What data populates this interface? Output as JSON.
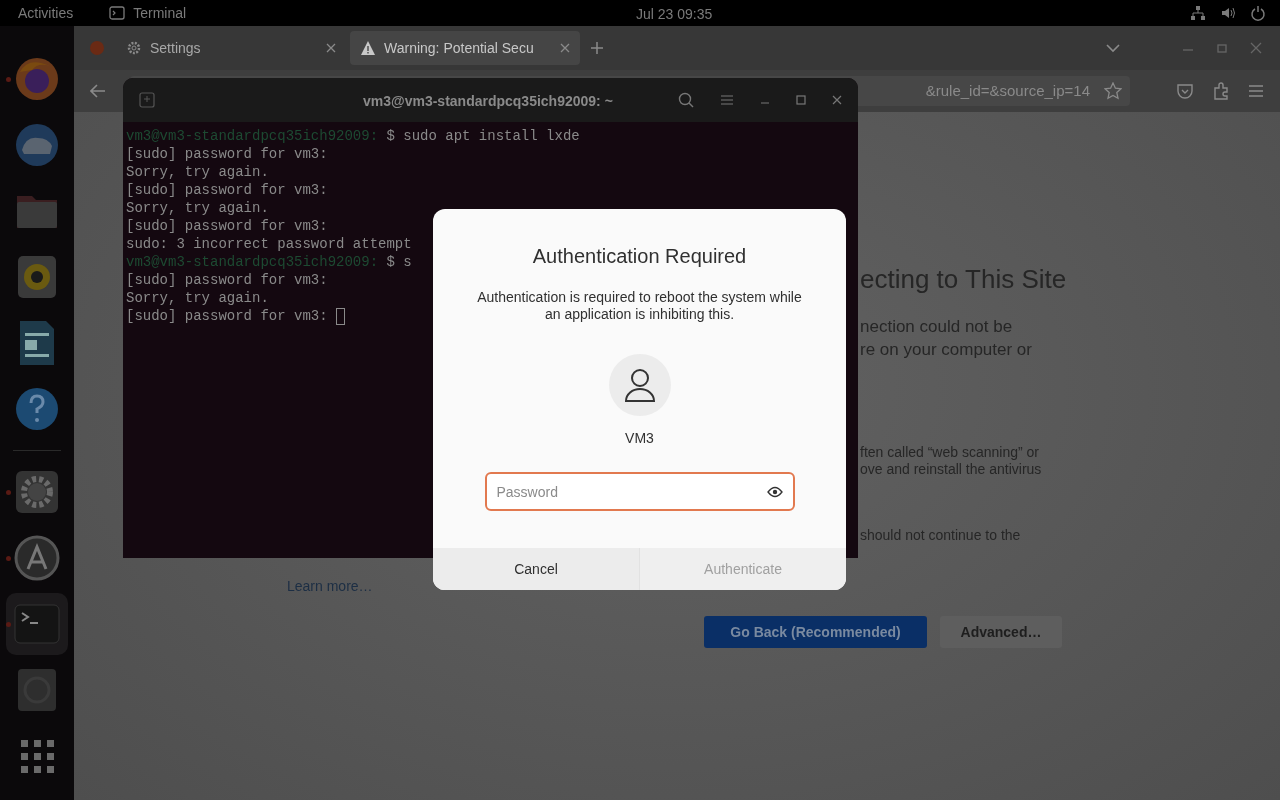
{
  "top_bar": {
    "activities": "Activities",
    "app": "Terminal",
    "clock": "Jul 23  09:35"
  },
  "dock": {
    "items": [
      {
        "kind": "firefox",
        "running": true,
        "selected": false
      },
      {
        "kind": "thunderbird",
        "running": false,
        "selected": false
      },
      {
        "kind": "files",
        "running": false,
        "selected": false
      },
      {
        "kind": "rhythmbox",
        "running": false,
        "selected": false
      },
      {
        "kind": "writer",
        "running": false,
        "selected": false
      },
      {
        "kind": "help",
        "running": false,
        "selected": false
      },
      {
        "kind": "separator"
      },
      {
        "kind": "settings",
        "running": true,
        "selected": false
      },
      {
        "kind": "software",
        "running": true,
        "selected": false
      },
      {
        "kind": "terminal",
        "running": true,
        "selected": true
      },
      {
        "kind": "disc",
        "running": false,
        "selected": false
      },
      {
        "kind": "apps",
        "running": false,
        "selected": false
      }
    ]
  },
  "browser": {
    "tabs": [
      {
        "kind": "pinned",
        "selected": false
      },
      {
        "kind": "settings",
        "label": "Settings",
        "selected": false
      },
      {
        "kind": "warning",
        "label": "Warning: Potential Secu",
        "selected": true
      }
    ],
    "url": "&rule_id=&source_ip=14",
    "page": {
      "heading": "ecting to This Site",
      "lines_1": [
        "nection could not be",
        "re on your computer or"
      ],
      "lines_2": [
        "ften called “web scanning” or",
        "ove and reinstall the antivirus"
      ],
      "lines_3": [
        "should not continue to the"
      ],
      "learn_more": "Learn more…",
      "primary_button": "Go Back (Recommended)",
      "secondary_button": "Advanced…"
    }
  },
  "terminal": {
    "title": "vm3@vm3-standardpcq35ich92009: ~",
    "cursor": true,
    "lines": [
      {
        "kind": "prompt",
        "prompt": "vm3@vm3-standardpcq35ich92009:",
        "text": " $ sudo apt install lxde"
      },
      {
        "kind": "output",
        "text": "[sudo] password for vm3:"
      },
      {
        "kind": "output",
        "text": "Sorry, try again."
      },
      {
        "kind": "output",
        "text": "[sudo] password for vm3:"
      },
      {
        "kind": "output",
        "text": "Sorry, try again."
      },
      {
        "kind": "output",
        "text": "[sudo] password for vm3:"
      },
      {
        "kind": "output",
        "text": "sudo: 3 incorrect password attempt"
      },
      {
        "kind": "prompt",
        "prompt": "vm3@vm3-standardpcq35ich92009:",
        "text": " $ s"
      },
      {
        "kind": "output",
        "text": "[sudo] password for vm3:"
      },
      {
        "kind": "output",
        "text": "Sorry, try again."
      },
      {
        "kind": "output",
        "text": "[sudo] password for vm3:"
      }
    ]
  },
  "dialog": {
    "title": "Authentication Required",
    "message": "Authentication is required to reboot the system while an application is inhibiting this.",
    "user": "VM3",
    "password": {
      "placeholder": "Password",
      "focused": true
    },
    "cancel": "Cancel",
    "authenticate": {
      "label": "Authenticate",
      "disabled": true
    }
  }
}
